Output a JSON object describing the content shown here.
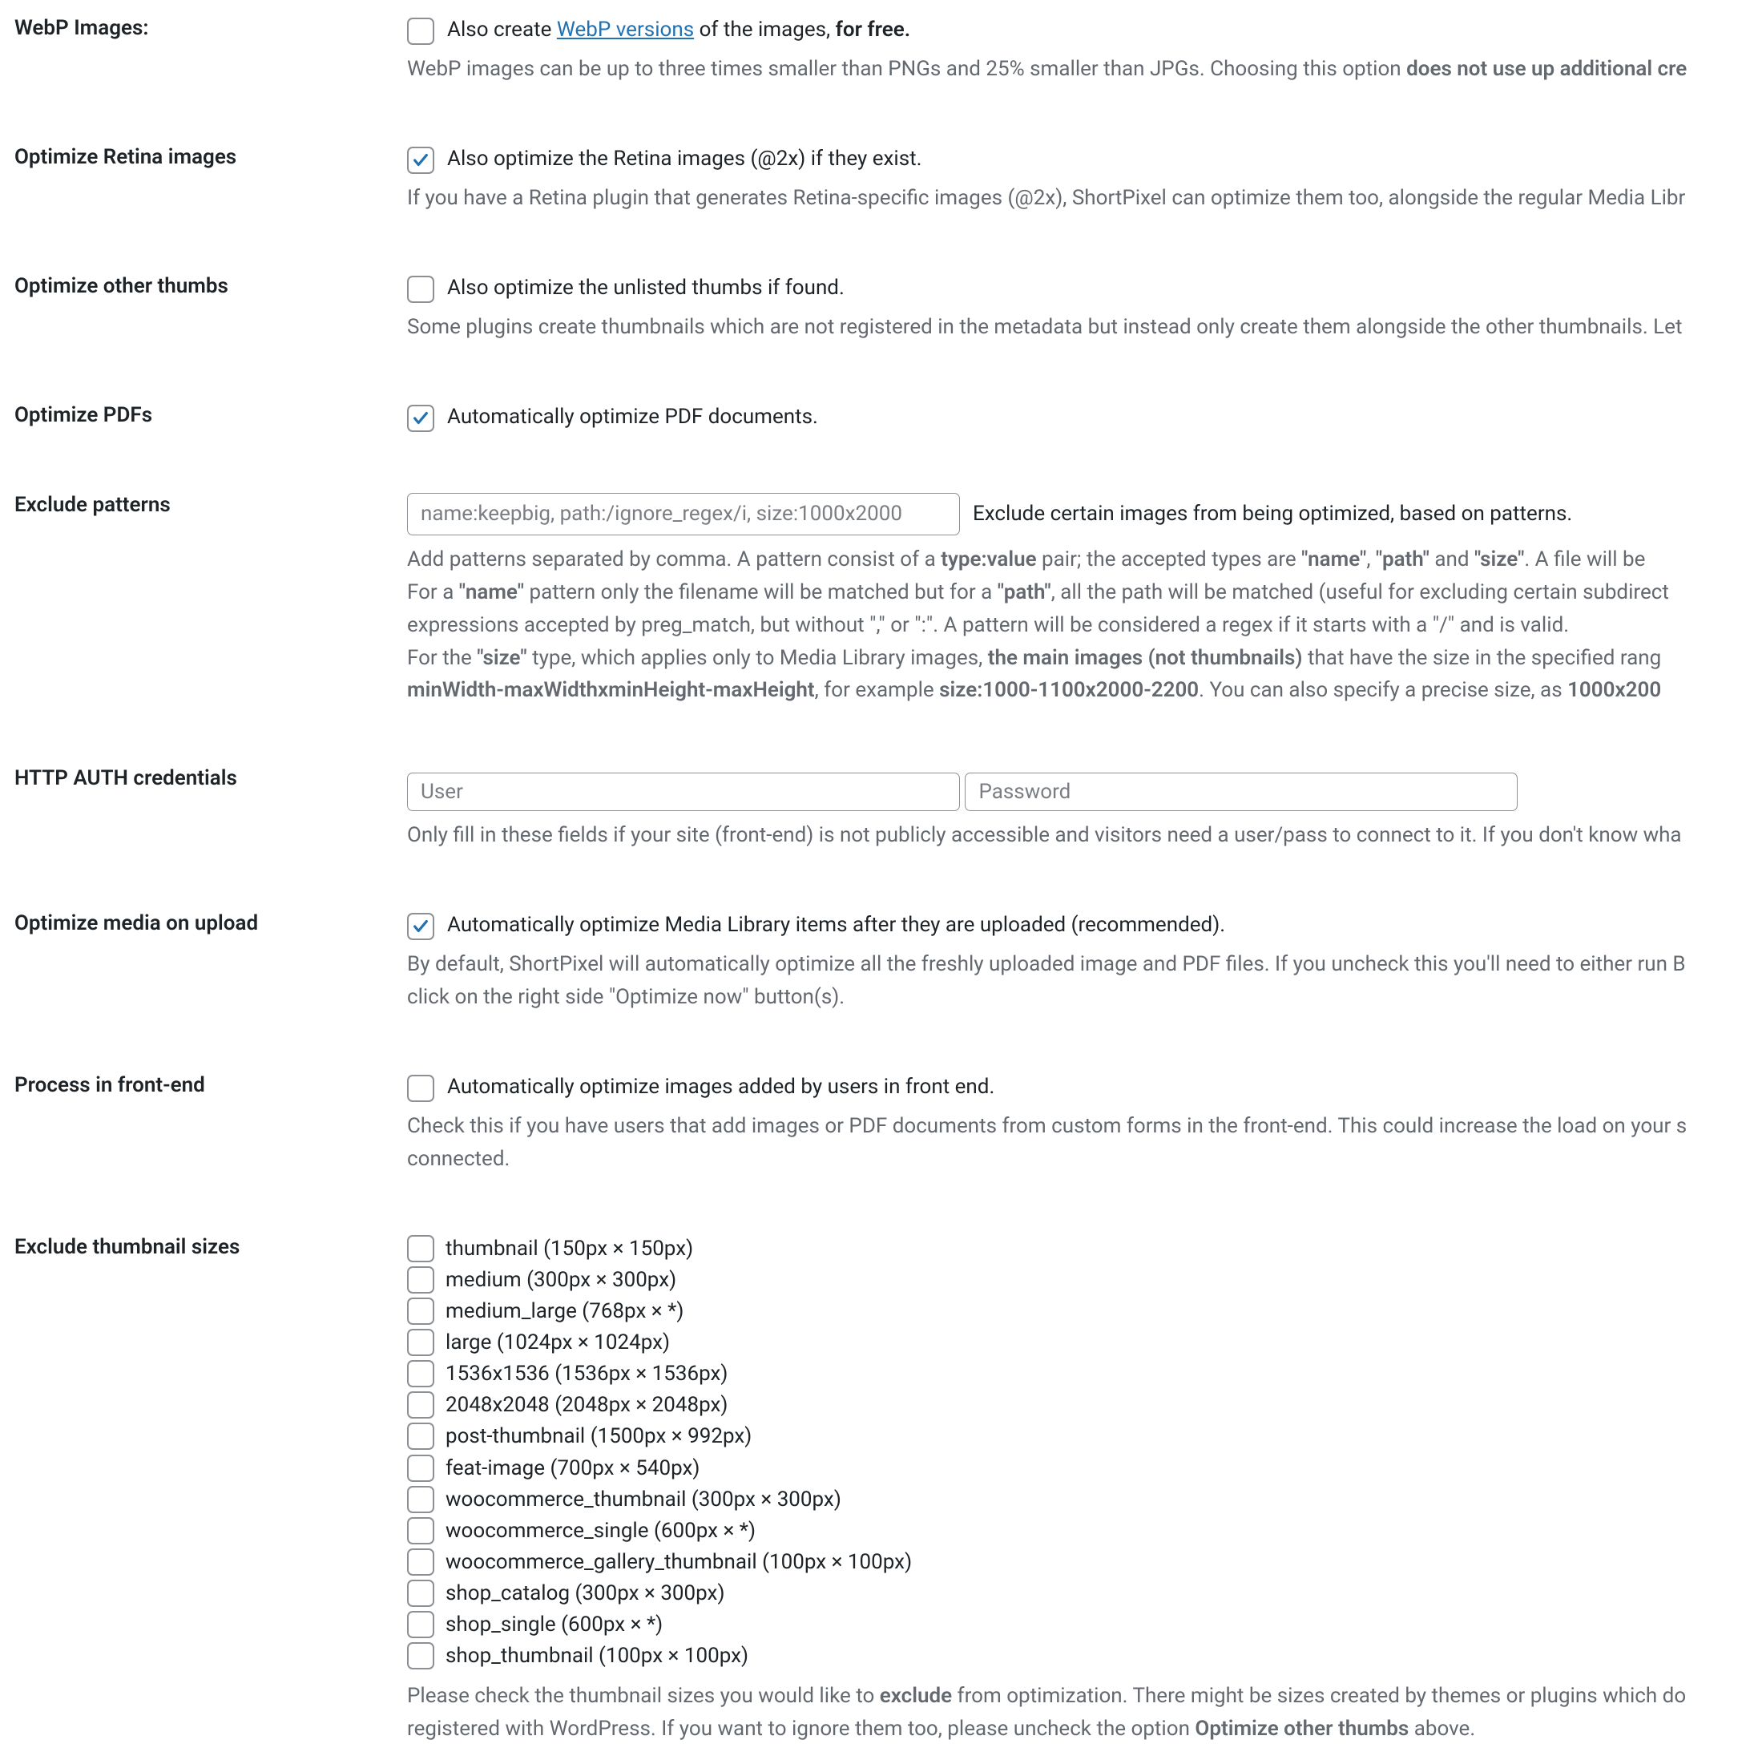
{
  "webp": {
    "label": "WebP Images:",
    "cb_checked": false,
    "text_pre": "Also create ",
    "link": "WebP versions",
    "text_mid": " of the images, ",
    "text_bold": "for free.",
    "desc_pre": "WebP images can be up to three times smaller than PNGs and 25% smaller than JPGs. Choosing this option ",
    "desc_bold": "does not use up additional cre"
  },
  "retina": {
    "label": "Optimize Retina images",
    "cb_checked": true,
    "text": "Also optimize the Retina images (@2x) if they exist.",
    "desc": "If you have a Retina plugin that generates Retina-specific images (@2x), ShortPixel can optimize them too, alongside the regular Media Libr"
  },
  "other_thumbs": {
    "label": "Optimize other thumbs",
    "cb_checked": false,
    "text": "Also optimize the unlisted thumbs if found.",
    "desc": "Some plugins create thumbnails which are not registered in the metadata but instead only create them alongside the other thumbnails. Let "
  },
  "pdf": {
    "label": "Optimize PDFs",
    "cb_checked": true,
    "text": "Automatically optimize PDF documents."
  },
  "exclude": {
    "label": "Exclude patterns",
    "placeholder": "name:keepbig, path:/ignore_regex/i, size:1000x2000",
    "after_input": "Exclude certain images from being optimized, based on patterns.",
    "d1a": "Add patterns separated by comma. A pattern consist of a ",
    "d1b": "type:value",
    "d1c": " pair; the accepted types are ",
    "d1name": "\"name\"",
    "d1comma": ", ",
    "d1path": "\"path\"",
    "d1and": " and ",
    "d1size": "\"size\"",
    "d1end": ". A file will be ",
    "d2a": "For a ",
    "d2name": "\"name\"",
    "d2b": " pattern only the filename will be matched but for a ",
    "d2path": "\"path\"",
    "d2c": ", all the path will be matched (useful for excluding certain subdirect",
    "d3": "expressions accepted by preg_match, but without \",\" or \":\". A pattern will be considered a regex if it starts with a \"/\" and is valid.",
    "d4a": "For the ",
    "d4size": "\"size\"",
    "d4b": " type, which applies only to Media Library images, ",
    "d4bold": "the main images (not thumbnails)",
    "d4c": " that have the size in the specified rang",
    "d5a": "minWidth-maxWidthxminHeight-maxHeight",
    "d5b": ", for example ",
    "d5c": "size:1000-1100x2000-2200",
    "d5d": ". You can also specify a precise size, as ",
    "d5e": "1000x200"
  },
  "auth": {
    "label": "HTTP AUTH credentials",
    "user_ph": "User",
    "pass_ph": "Password",
    "desc": "Only fill in these fields if your site (front-end) is not publicly accessible and visitors need a user/pass to connect to it. If you don't know wha"
  },
  "on_upload": {
    "label": "Optimize media on upload",
    "cb_checked": true,
    "text": "Automatically optimize Media Library items after they are uploaded (recommended).",
    "desc1": "By default, ShortPixel will automatically optimize all the freshly uploaded image and PDF files. If you uncheck this you'll need to either run B",
    "desc2": "click on the right side \"Optimize now\" button(s)."
  },
  "frontend": {
    "label": "Process in front-end",
    "cb_checked": false,
    "text": "Automatically optimize images added by users in front end.",
    "desc1": "Check this if you have users that add images or PDF documents from custom forms in the front-end. This could increase the load on your s",
    "desc2": "connected."
  },
  "thumb_sizes": {
    "label": "Exclude thumbnail sizes",
    "items": [
      "thumbnail (150px × 150px)",
      "medium (300px × 300px)",
      "medium_large (768px × *)",
      "large (1024px × 1024px)",
      "1536x1536 (1536px × 1536px)",
      "2048x2048 (2048px × 2048px)",
      "post-thumbnail (1500px × 992px)",
      "feat-image (700px × 540px)",
      "woocommerce_thumbnail (300px × 300px)",
      "woocommerce_single (600px × *)",
      "woocommerce_gallery_thumbnail (100px × 100px)",
      "shop_catalog (300px × 300px)",
      "shop_single (600px × *)",
      "shop_thumbnail (100px × 100px)"
    ],
    "desc_a": "Please check the thumbnail sizes you would like to ",
    "desc_b": "exclude",
    "desc_c": " from optimization. There might be sizes created by themes or plugins which do",
    "desc2a": "registered with WordPress. If you want to ignore them too, please uncheck the option ",
    "desc2b": "Optimize other thumbs",
    "desc2c": " above."
  }
}
